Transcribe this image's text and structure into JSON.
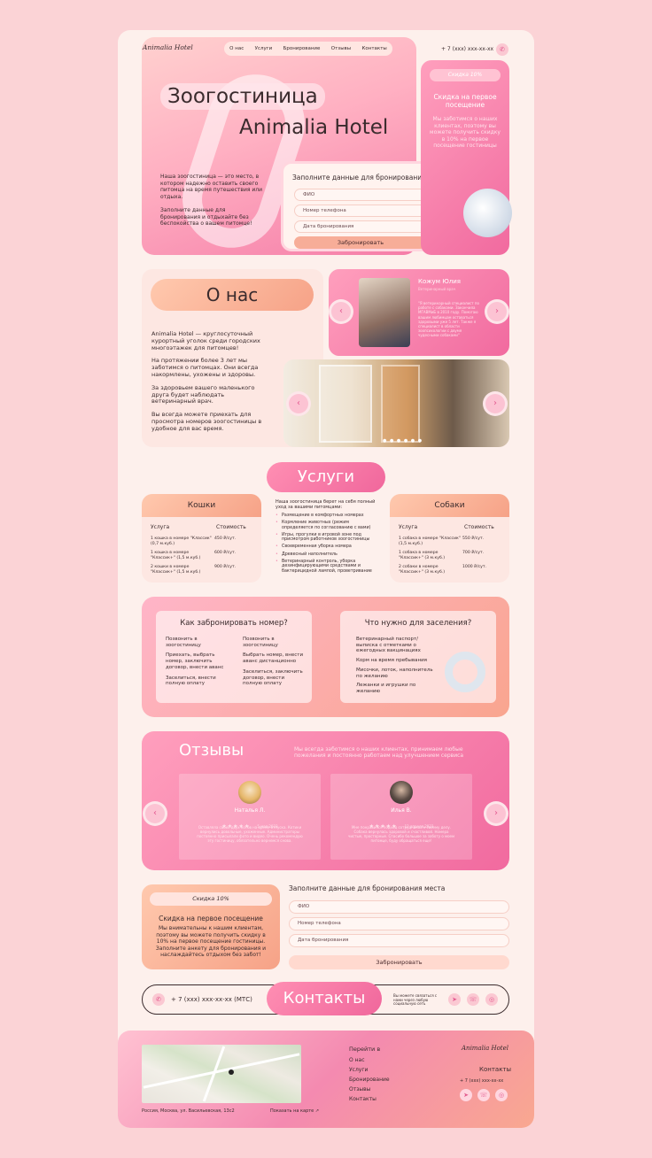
{
  "header": {
    "logo": "Animalia Hotel",
    "nav": [
      "О нас",
      "Услуги",
      "Бронирование",
      "Отзывы",
      "Контакты"
    ],
    "phone": "+ 7 (xxx) xxx-xx-xx"
  },
  "hero": {
    "title1": "Зоогостиница",
    "title2": "Animalia Hotel",
    "text1": "Наша зоогостиница — это место, в котором надежно оставить своего питомца на время путешествия или отдыха.",
    "text2": "Заполните данные для бронирования и отдыхайте без беспокойства о вашем питомце!"
  },
  "booking_hero": {
    "title": "Заполните данные для бронирования",
    "fields": [
      "ФИО",
      "Номер телефона",
      "Дата бронирования"
    ],
    "button": "Забронировать"
  },
  "promo": {
    "badge": "Скидка 10%",
    "title": "Скидка на первое посещение",
    "text": "Мы заботимся о наших клиентах, поэтому вы можете получить скидку в 10% на первое посещение гостиницы"
  },
  "about": {
    "title": "О нас",
    "p1": "Animalia Hotel — круглосуточный курортный уголок среди городских многоэтажек для питомцев!",
    "p2": "На протяжении более 3 лет мы заботимся о питомцах. Они всегда накормлены, ухожены и здоровы.",
    "p3": "За здоровьем вашего маленького друга будет наблюдать ветеринарный врач.",
    "p4": "Вы всегда можете приехать для просмотра номеров зоогостиницы в удобное для вас время."
  },
  "vet": {
    "name": "Кожум Юлия",
    "role": "Ветеринарный врач",
    "text": "\"Я ветеринарный специалист по работе с собаками. Закончила МГАВМиБ в 2010 году. Помогаю вашим любимцам оставаться здоровыми уже 5 лет. Также я специалист в области зоопсихологии с двумя чудесными собаками\""
  },
  "services": {
    "title": "Услуги",
    "cats": {
      "title": "Кошки",
      "col1": "Услуга",
      "col2": "Стоимость",
      "rows": [
        [
          "1 кошка в номере \"Классик\" (0,7 м.куб.)",
          "450 ₽/сут."
        ],
        [
          "1 кошка в номере \"Классик+\" (1,5 м.куб.)",
          "600 ₽/сут."
        ],
        [
          "2 кошки в номере \"Классик+\" (1,5 м.куб.)",
          "900 ₽/сут."
        ]
      ]
    },
    "dogs": {
      "title": "Собаки",
      "col1": "Услуга",
      "col2": "Стоимость",
      "rows": [
        [
          "1 собака в номере \"Классик\" (1,5 м.куб.)",
          "550 ₽/сут."
        ],
        [
          "1 собака в номере \"Классик+\" (3 м.куб.)",
          "700 ₽/сут."
        ],
        [
          "2 собаки в номере \"Классик+\" (3 м.куб.)",
          "1000 ₽/сут."
        ]
      ]
    },
    "intro": "Наша зоогостиница берет на себя полный уход за вашими питомцами:",
    "list": [
      "Размещение в комфортных номерах",
      "Кормление животных (режим определяется по согласованию с вами)",
      "Игры, прогулки в игровой зоне под присмотром работников зоогостиницы",
      "Своевременная уборка номера",
      "Древесный наполнитель",
      "Ветеринарный контроль, уборка дезинфицирующими средствами и бактерицидной лампой, проветривание"
    ]
  },
  "howto": {
    "title": "Как забронировать номер?",
    "col1": [
      "Позвонить в зоогостиницу",
      "Приехать, выбрать номер, заключить договор, внести аванс",
      "Заселиться, внести полную оплату"
    ],
    "col2": [
      "Позвонить в зоогостиницу",
      "Выбрать номер, внести аванс дистанционно",
      "Заселиться, заключить договор, внести полную оплату"
    ]
  },
  "need": {
    "title": "Что нужно для заселения?",
    "items": [
      "Ветеринарный паспорт/ выписка с отметками о ежегодных вакцинациях",
      "Корм на время пребывания",
      "Мисочки, лоток, наполнитель по желанию",
      "Лежанки и игрушки по желанию"
    ]
  },
  "reviews": {
    "title": "Отзывы",
    "subtitle": "Мы всегда заботимся о наших клиентах, принимаем любые пожелания и постоянно работаем над улучшением сервиса",
    "items": [
      {
        "name": "Наталья Л.",
        "date": "5 мая 2023",
        "stars": "★★★★★",
        "text": "Оставляла своих двух котов на время отпуска. Котики вернулись довольные, ухоженные. Администраторы постоянно присылали фото и видео. Очень рекомендую эту гостиницу, обязательно вернемся снова."
      },
      {
        "name": "Илья В.",
        "date": "12 апреля 2023",
        "stars": "★★★★★",
        "text": "Мне понравился подход сотрудников к своему делу. Собака вернулась здоровой и счастливой. Номера чистые, просторные. Спасибо большое за заботу о моем питомце, буду обращаться еще!"
      }
    ]
  },
  "promo2": {
    "badge": "Скидка 10%",
    "title": "Скидка на первое посещение",
    "text": "Мы внимательны к нашим клиентам, поэтому вы можете получить скидку в 10% на первое посещение гостиницы. Заполните анкету для бронирования и наслаждайтесь отдыхом без забот!"
  },
  "booking2": {
    "title": "Заполните данные для бронирования места",
    "fields": [
      "ФИО",
      "Номер телефона",
      "Дата бронирования"
    ],
    "button": "Забронировать"
  },
  "contacts": {
    "phone": "+ 7 (xxx) xxx-xx-xx (МТС)",
    "title": "Контакты",
    "note": "Вы можете связаться с нами через любую социальную сеть"
  },
  "footer": {
    "address": "Россия, Москва, ул. Васильевская, 13с2",
    "map_link": "Показать на карте ↗",
    "nav_title": "Перейти в",
    "nav": [
      "О нас",
      "Услуги",
      "Бронирование",
      "Отзывы",
      "Контакты"
    ],
    "logo": "Animalia Hotel",
    "contacts_title": "Контакты",
    "phone": "+ 7 (xxx) xxx-xx-xx"
  }
}
